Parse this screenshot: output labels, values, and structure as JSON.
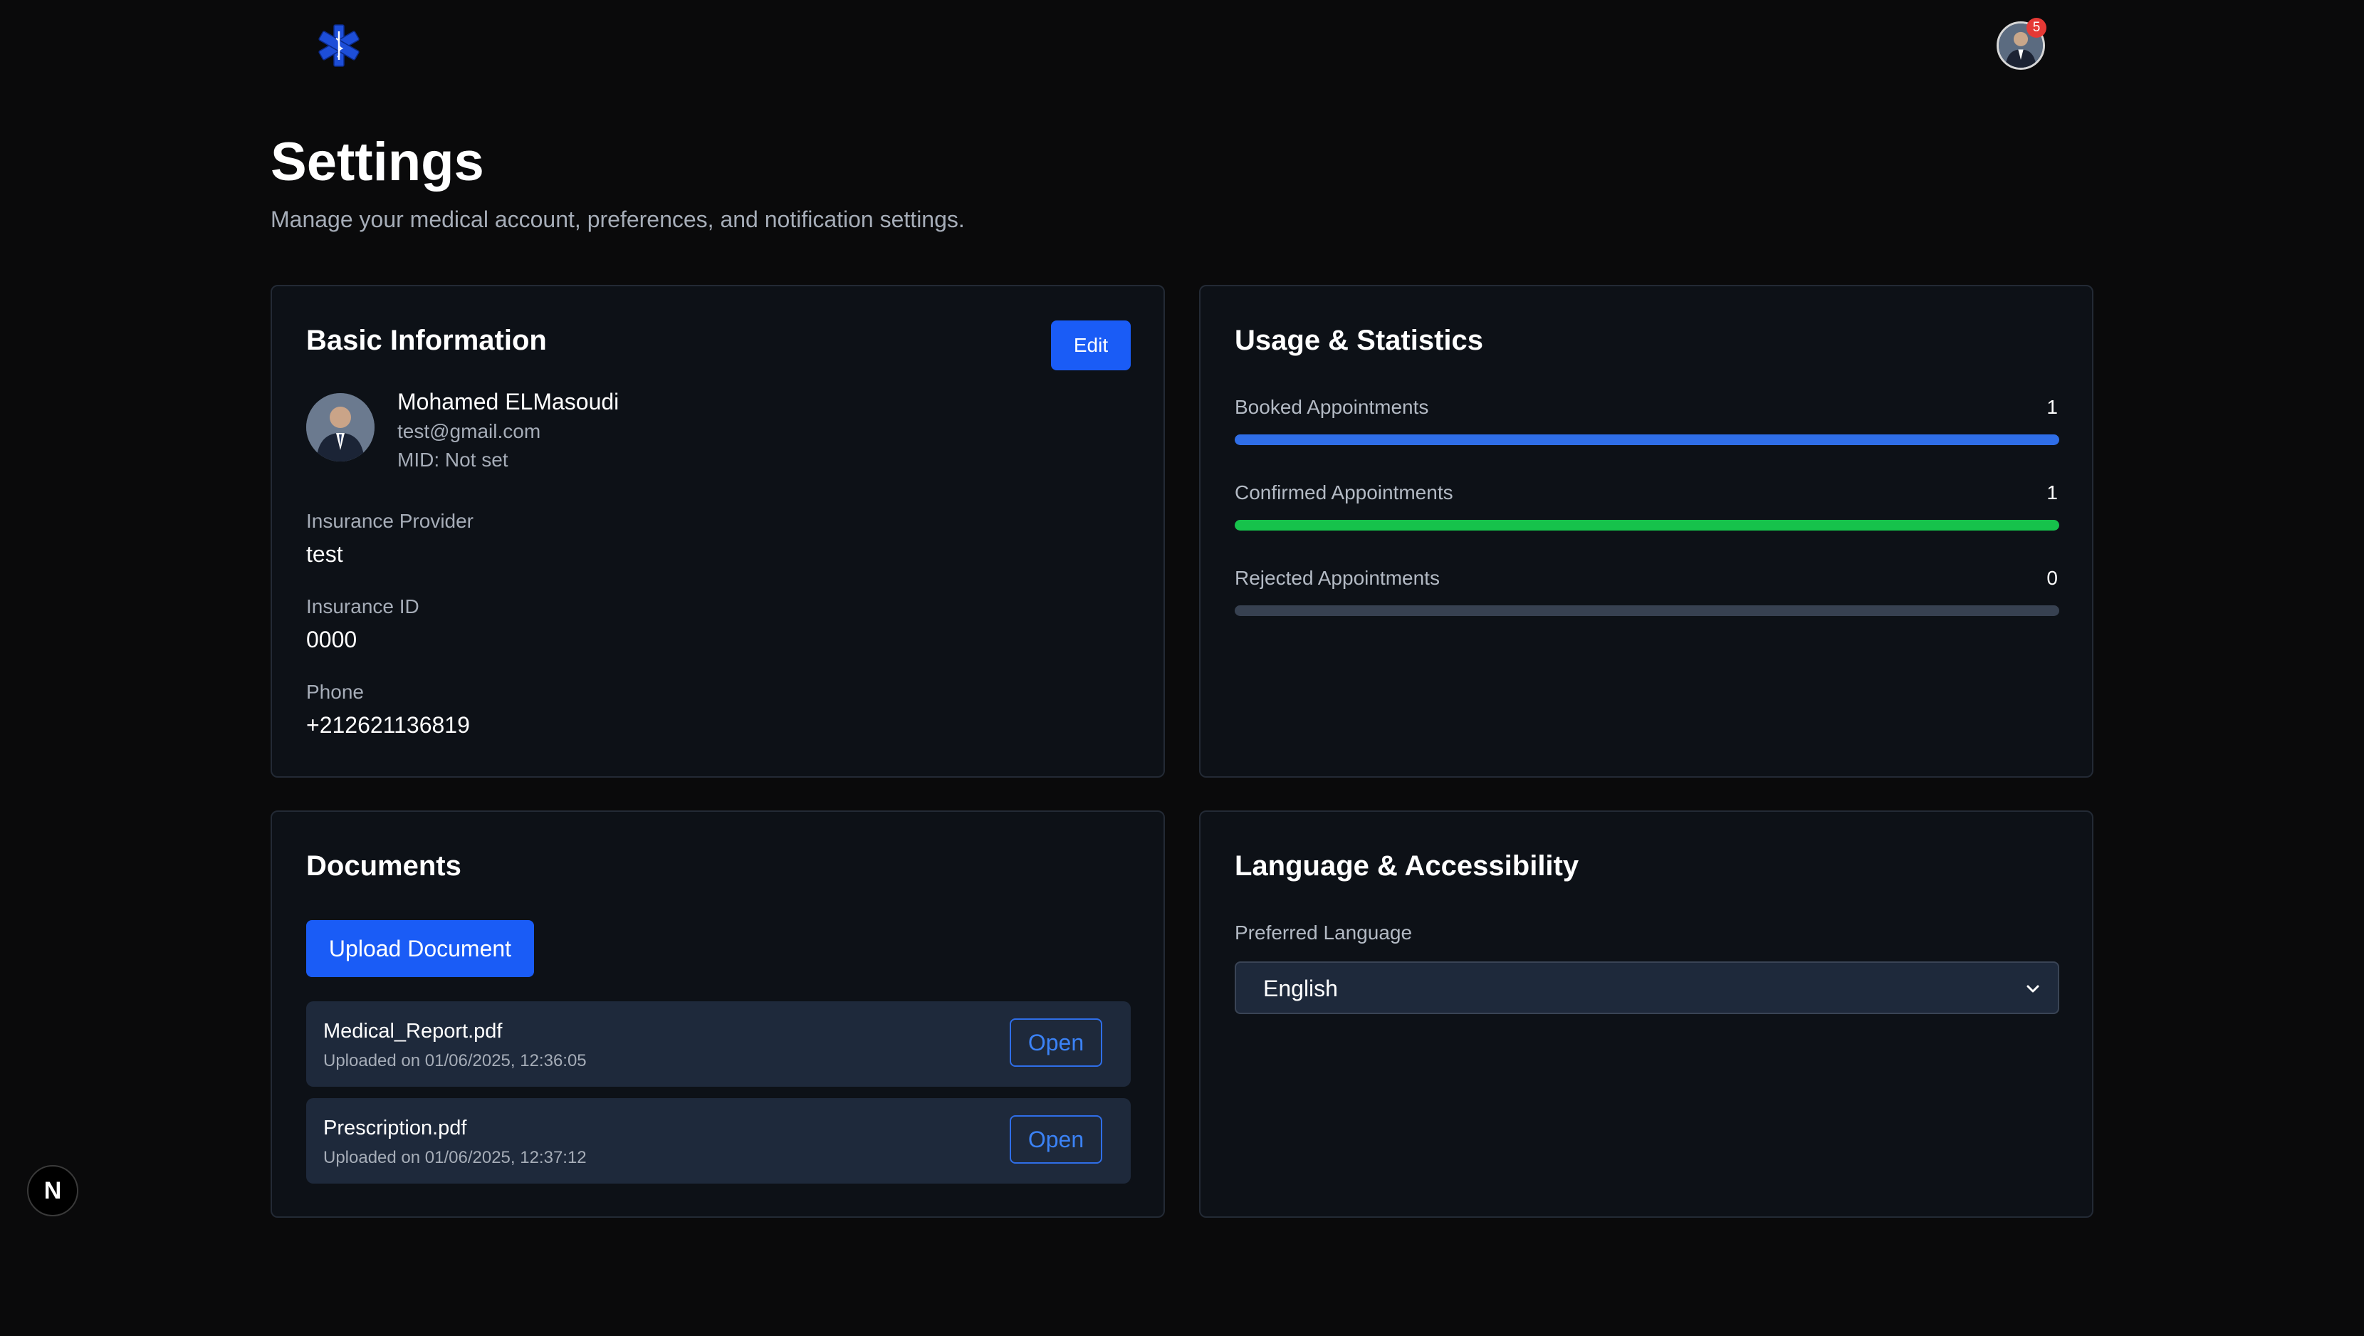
{
  "header": {
    "logo_icon": "star-of-life-icon",
    "notification_count": "5",
    "avatar_icon": "user-avatar"
  },
  "page": {
    "title": "Settings",
    "subtitle": "Manage your medical account, preferences, and notification settings."
  },
  "basic_info": {
    "title": "Basic Information",
    "edit_label": "Edit",
    "name": "Mohamed ELMasoudi",
    "email": "test@gmail.com",
    "mid": "MID: Not set",
    "fields": [
      {
        "label": "Insurance Provider",
        "value": "test"
      },
      {
        "label": "Insurance ID",
        "value": "0000"
      },
      {
        "label": "Phone",
        "value": "+212621136819"
      }
    ]
  },
  "usage": {
    "title": "Usage & Statistics",
    "stats": [
      {
        "label": "Booked Appointments",
        "value": "1",
        "fill_fraction": 1.0,
        "color": "#2f6ee8"
      },
      {
        "label": "Confirmed Appointments",
        "value": "1",
        "fill_fraction": 1.0,
        "color": "#16c24b"
      },
      {
        "label": "Rejected Appointments",
        "value": "0",
        "fill_fraction": 0.0,
        "color": "#374151"
      }
    ]
  },
  "documents": {
    "title": "Documents",
    "upload_label": "Upload Document",
    "items": [
      {
        "name": "Medical_Report.pdf",
        "uploaded": "Uploaded on 01/06/2025, 12:36:05",
        "action": "Open"
      },
      {
        "name": "Prescription.pdf",
        "uploaded": "Uploaded on 01/06/2025, 12:37:12",
        "action": "Open"
      }
    ]
  },
  "language": {
    "title": "Language & Accessibility",
    "preferred_label": "Preferred Language",
    "selected": "English"
  },
  "dev_indicator": {
    "label": "N"
  },
  "colors": {
    "accent": "#1a5cf6",
    "success": "#16c24b",
    "badge": "#e53935",
    "background": "#0a0a0b",
    "card": "#0d1117"
  }
}
